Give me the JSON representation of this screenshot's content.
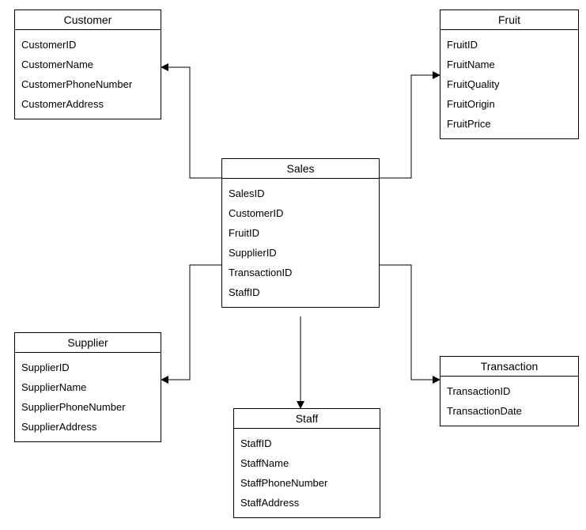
{
  "entities": {
    "customer": {
      "title": "Customer",
      "attrs": [
        "CustomerID",
        "CustomerName",
        "CustomerPhoneNumber",
        "CustomerAddress"
      ]
    },
    "fruit": {
      "title": "Fruit",
      "attrs": [
        "FruitID",
        "FruitName",
        "FruitQuality",
        "FruitOrigin",
        "FruitPrice"
      ]
    },
    "sales": {
      "title": "Sales",
      "attrs": [
        "SalesID",
        "CustomerID",
        "FruitID",
        "SupplierID",
        "TransactionID",
        "StaffID"
      ]
    },
    "supplier": {
      "title": "Supplier",
      "attrs": [
        "SupplierID",
        "SupplierName",
        "SupplierPhoneNumber",
        "SupplierAddress"
      ]
    },
    "transaction": {
      "title": "Transaction",
      "attrs": [
        "TransactionID",
        "TransactionDate"
      ]
    },
    "staff": {
      "title": "Staff",
      "attrs": [
        "StaffID",
        "StaffName",
        "StaffPhoneNumber",
        "StaffAddress"
      ]
    }
  },
  "relationships": [
    {
      "from": "sales",
      "to": "customer",
      "via": "CustomerID"
    },
    {
      "from": "sales",
      "to": "fruit",
      "via": "FruitID"
    },
    {
      "from": "sales",
      "to": "supplier",
      "via": "SupplierID"
    },
    {
      "from": "sales",
      "to": "transaction",
      "via": "TransactionID"
    },
    {
      "from": "sales",
      "to": "staff",
      "via": "StaffID"
    }
  ]
}
